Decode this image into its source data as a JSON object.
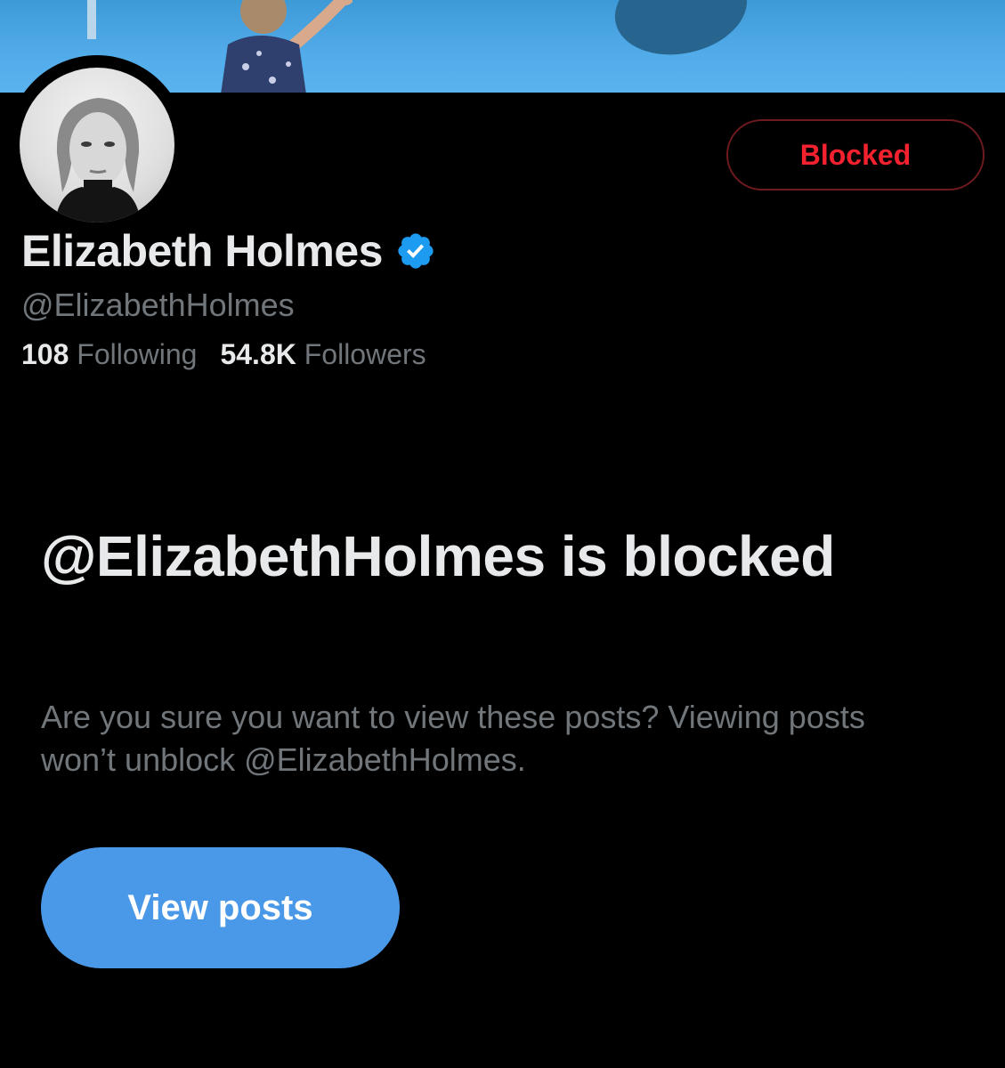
{
  "profile": {
    "display_name": "Elizabeth Holmes",
    "handle": "@ElizabethHolmes",
    "verified": true,
    "following_count": "108",
    "following_label": "Following",
    "followers_count": "54.8K",
    "followers_label": "Followers",
    "block_button_label": "Blocked"
  },
  "blocked_notice": {
    "heading": "@ElizabethHolmes is blocked",
    "description": "Are you sure you want to view these posts? Viewing posts won’t unblock @ElizabethHolmes.",
    "view_button_label": "View posts"
  },
  "icons": {
    "verified_badge": "verified-badge-icon"
  },
  "colors": {
    "background": "#000000",
    "primary_text": "#e7e9ea",
    "secondary_text": "#71767b",
    "blocked_red": "#f4212e",
    "accent_blue": "#4a99e9",
    "verified_blue": "#1d9bf0"
  }
}
